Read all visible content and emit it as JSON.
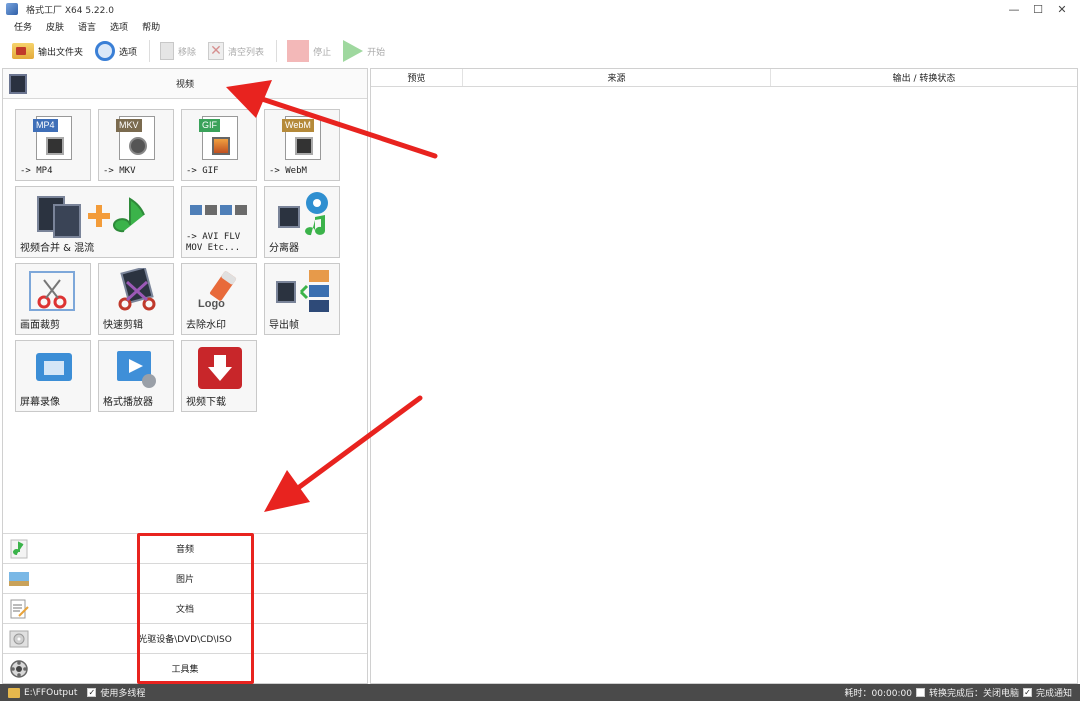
{
  "window": {
    "title": "格式工厂 X64 5.22.0",
    "controls": [
      "—",
      "☐",
      "✕"
    ]
  },
  "menu": [
    "任务",
    "皮肤",
    "语言",
    "选项",
    "帮助"
  ],
  "toolbar": {
    "output_folder": "输出文件夹",
    "options": "选项",
    "remove": "移除",
    "clear_list": "清空列表",
    "stop": "停止",
    "start": "开始"
  },
  "video_category": {
    "label": "视频",
    "tiles": [
      {
        "label": "-> MP4",
        "badge": "MP4",
        "badge_color": "#3f6fb8"
      },
      {
        "label": "-> MKV",
        "badge": "MKV",
        "badge_color": "#7b6b4f"
      },
      {
        "label": "-> GIF",
        "badge": "GIF",
        "badge_color": "#3aa25a"
      },
      {
        "label": "-> WebM",
        "badge": "WebM",
        "badge_color": "#b58a3a"
      },
      {
        "label": "视频合并 & 混流"
      },
      {
        "label": "-> AVI FLV\nMOV Etc..."
      },
      {
        "label": "分离器"
      },
      {
        "label": "画面裁剪"
      },
      {
        "label": "快速剪辑"
      },
      {
        "label": "去除水印"
      },
      {
        "label": "导出帧"
      },
      {
        "label": "屏幕录像"
      },
      {
        "label": "格式播放器"
      },
      {
        "label": "视频下载"
      }
    ],
    "watermark_logo_text": "Logo"
  },
  "categories": [
    {
      "label": "音频",
      "icon": "music-note-icon"
    },
    {
      "label": "图片",
      "icon": "picture-icon"
    },
    {
      "label": "文档",
      "icon": "document-icon"
    },
    {
      "label": "光驱设备\\DVD\\CD\\ISO",
      "icon": "disc-icon"
    },
    {
      "label": "工具集",
      "icon": "toolbox-icon"
    }
  ],
  "list_columns": [
    "预览",
    "来源",
    "输出 / 转换状态"
  ],
  "status": {
    "output_path": "E:\\FFOutput",
    "multithread_label": "使用多线程",
    "multithread_checked": true,
    "elapsed": "耗时：00:00:00",
    "after_convert_label": "转换完成后：关闭电脑",
    "after_convert_checked": false,
    "notify_label": "完成通知",
    "notify_checked": true
  },
  "annotation": {
    "arrow_color": "#e8231f",
    "box_color": "#e8231f"
  }
}
